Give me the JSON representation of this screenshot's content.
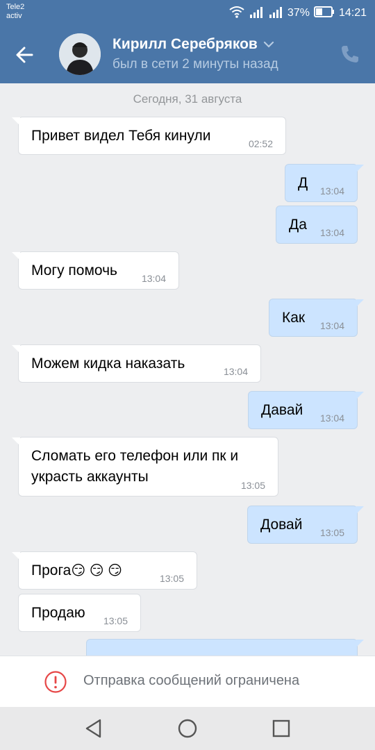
{
  "status_bar": {
    "carrier_line1": "Tele2",
    "carrier_line2": "activ",
    "battery": "37%",
    "time": "14:21",
    "icons": [
      "wifi-icon",
      "signal-icon",
      "signal-icon",
      "battery-icon"
    ]
  },
  "header": {
    "contact_name": "Кирилл Серебряков",
    "last_seen": "был в сети 2 минуты назад",
    "icons": [
      "back-arrow-icon",
      "chevron-down-icon",
      "phone-icon"
    ]
  },
  "chat": {
    "date_separator": "Сегодня, 31 августа",
    "messages": [
      {
        "dir": "in",
        "text": "Привет видел Тебя кинули",
        "time": "02:52"
      },
      {
        "dir": "out",
        "text": "Д",
        "time": "13:04"
      },
      {
        "dir": "out",
        "text": "Да",
        "time": "13:04"
      },
      {
        "dir": "in",
        "text": "Могу помочь",
        "time": "13:04"
      },
      {
        "dir": "out",
        "text": "Как",
        "time": "13:04"
      },
      {
        "dir": "in",
        "text": "Можем кидка наказать",
        "time": "13:04"
      },
      {
        "dir": "out",
        "text": "Давай",
        "time": "13:04"
      },
      {
        "dir": "in",
        "text": "Сломать его телефон или пк и",
        "text2": "украсть аккаунты",
        "time": "13:05"
      },
      {
        "dir": "out",
        "text": "Довай",
        "time": "13:05"
      },
      {
        "dir": "in",
        "text": "Прога",
        "emoji": "😏 😏 😏",
        "time": "13:05"
      },
      {
        "dir": "in",
        "text": "Продаю",
        "time": "13:05"
      }
    ]
  },
  "restriction": {
    "text": "Отправка сообщений ограничена",
    "icon": "warning-icon"
  },
  "nav": {
    "icons": [
      "back-triangle-icon",
      "home-circle-icon",
      "recents-square-icon"
    ]
  },
  "colors": {
    "header_bg": "#4a76a8",
    "chat_bg": "#edeef0",
    "incoming_bubble": "#ffffff",
    "outgoing_bubble": "#cce4ff",
    "warning_red": "#e64646"
  }
}
